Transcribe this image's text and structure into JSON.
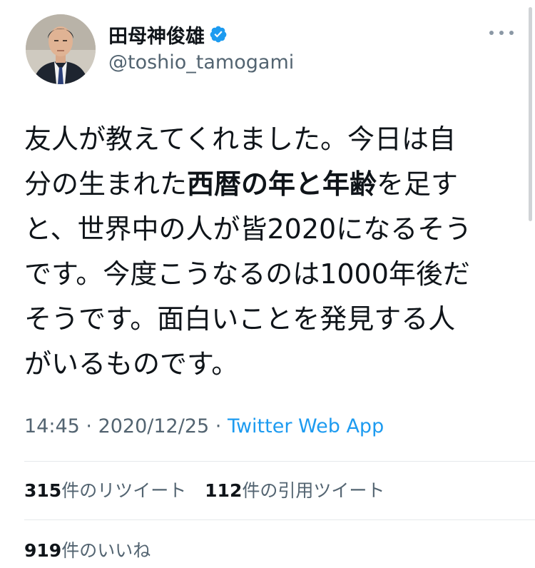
{
  "author": {
    "display_name": "田母神俊雄",
    "handle": "@toshio_tamogami",
    "verified_icon": "verified-badge-icon",
    "accent_color": "#1d9bf0"
  },
  "tweet": {
    "lines": [
      [
        {
          "text": "友人が教えてくれました。今日は自",
          "bold": false
        }
      ],
      [
        {
          "text": "分の生まれた",
          "bold": false
        },
        {
          "text": "西暦の年と年齢",
          "bold": true
        },
        {
          "text": "を足す",
          "bold": false
        }
      ],
      [
        {
          "text": "と、世界中の人が皆2020になるそう",
          "bold": false
        }
      ],
      [
        {
          "text": "です。今度こうなるのは1000年後だ",
          "bold": false
        }
      ],
      [
        {
          "text": "そうです。面白いことを発見する人",
          "bold": false
        }
      ],
      [
        {
          "text": "がいるものです。",
          "bold": false
        }
      ]
    ]
  },
  "meta": {
    "time": "14:45",
    "separator": " · ",
    "date": "2020/12/25",
    "separator2": " · ",
    "source": "Twitter Web App"
  },
  "stats": {
    "retweets_count": "315",
    "retweets_label": "件のリツイート",
    "quotes_count": "112",
    "quotes_label": "件の引用ツイート",
    "likes_count": "919",
    "likes_label": "件のいいね"
  },
  "icons": {
    "more": "more-options-icon"
  }
}
